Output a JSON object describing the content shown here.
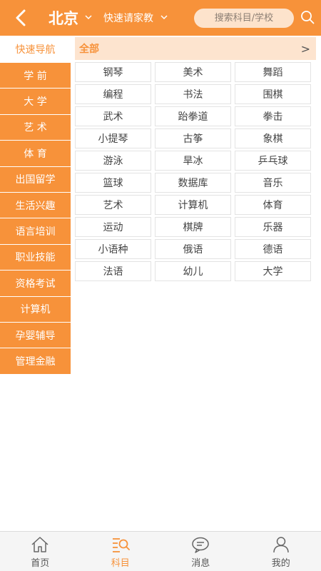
{
  "header": {
    "city": "北京",
    "mode": "快速请家教",
    "search_placeholder": "搜索科目/学校"
  },
  "sidebar": {
    "items": [
      {
        "label": "快速导航"
      },
      {
        "label": "学 前"
      },
      {
        "label": "大 学"
      },
      {
        "label": "艺 术"
      },
      {
        "label": "体 育"
      },
      {
        "label": "出国留学"
      },
      {
        "label": "生活兴趣"
      },
      {
        "label": "语言培训"
      },
      {
        "label": "职业技能"
      },
      {
        "label": "资格考试"
      },
      {
        "label": "计算机"
      },
      {
        "label": "孕婴辅导"
      },
      {
        "label": "管理金融"
      }
    ]
  },
  "main": {
    "all_label": "全部",
    "all_chevron": ">",
    "subjects": [
      "钢琴",
      "美术",
      "舞蹈",
      "编程",
      "书法",
      "围棋",
      "武术",
      "跆拳道",
      "拳击",
      "小提琴",
      "古筝",
      "象棋",
      "游泳",
      "旱冰",
      "乒乓球",
      "篮球",
      "数据库",
      "音乐",
      "艺术",
      "计算机",
      "体育",
      "运动",
      "棋牌",
      "乐器",
      "小语种",
      "俄语",
      "德语",
      "法语",
      "幼儿",
      "大学"
    ]
  },
  "tabbar": {
    "tabs": [
      {
        "label": "首页",
        "icon": "home-icon"
      },
      {
        "label": "科目",
        "icon": "category-search-icon"
      },
      {
        "label": "消息",
        "icon": "message-icon"
      },
      {
        "label": "我的",
        "icon": "user-icon"
      }
    ]
  },
  "colors": {
    "accent": "#f7923a",
    "accent_light": "#fde4cf"
  }
}
